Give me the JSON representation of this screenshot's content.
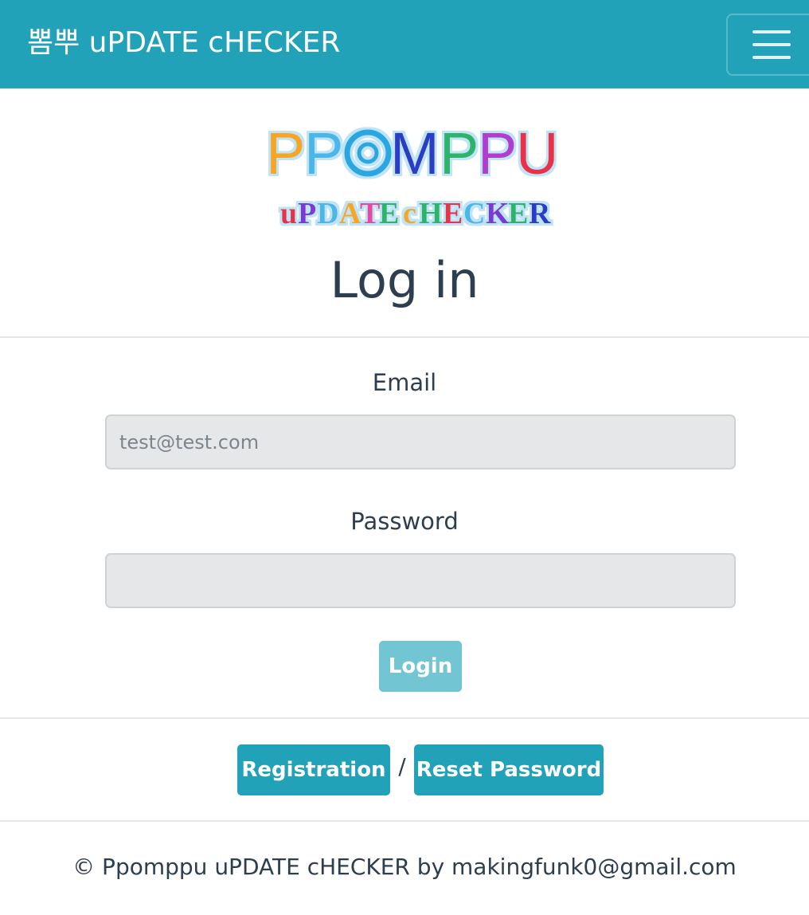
{
  "navbar": {
    "brand": "뽐뿌 uPDATE cHECKER",
    "menu_icon": "hamburger-menu-icon",
    "background_color": "#22a2b9"
  },
  "logo": {
    "line1": "PPOMPPU",
    "line2": "uPDATE cHECKER"
  },
  "page": {
    "title": "Log in"
  },
  "form": {
    "email_label": "Email",
    "email_placeholder": "test@test.com",
    "password_label": "Password",
    "password_placeholder": "",
    "login_label": "Login"
  },
  "links": {
    "registration_label": "Registration",
    "separator": "/",
    "reset_label": "Reset Password"
  },
  "footer": {
    "text": "© Ppomppu uPDATE cHECKER by makingfunk0@gmail.com"
  },
  "colors": {
    "accent": "#22a2b9",
    "login_button": "#72c6d4",
    "input_background": "#e6e7e9"
  }
}
